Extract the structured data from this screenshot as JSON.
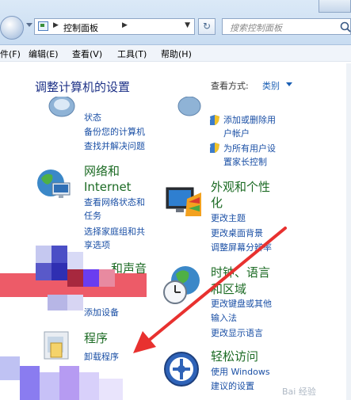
{
  "toolbar": {
    "address_text": "控制面板",
    "search_placeholder": "搜索控制面板"
  },
  "menu": [
    "件(F)",
    "编辑(E)",
    "查看(V)",
    "工具(T)",
    "帮助(H)"
  ],
  "header": {
    "title": "调整计算机的设置",
    "view_by_label": "查看方式:",
    "view_by_value": "类别"
  },
  "left_categories": [
    {
      "title": "",
      "links": [
        "状态",
        "备份您的计算机",
        "查找并解决问题"
      ]
    },
    {
      "title_line1": "网络和",
      "title_line2": "Internet",
      "links": [
        "查看网络状态和",
        "任务",
        "选择家庭组和共",
        "享选项"
      ]
    },
    {
      "title": "和声音",
      "links": [
        "添加设备"
      ]
    },
    {
      "title": "程序",
      "links": [
        "卸载程序"
      ]
    }
  ],
  "right_categories": [
    {
      "links": [
        "添加或删除用",
        "户帐户",
        "为所有用户设",
        "置家长控制"
      ]
    },
    {
      "title_line1": "外观和个性",
      "title_line2": "化",
      "links": [
        "更改主题",
        "更改桌面背景",
        "调整屏幕分辨率"
      ]
    },
    {
      "title_line1": "时钟、语言",
      "title_line2": "和区域",
      "links": [
        "更改键盘或其他",
        "输入法",
        "更改显示语言"
      ]
    },
    {
      "title": "轻松访问",
      "links": [
        "使用 Windows",
        "建议的设置"
      ]
    }
  ],
  "watermark": "Bai 经验",
  "colors": {
    "category_title": "#1c6b24",
    "link": "#1a4fa5",
    "accent_arrow": "#e8312f"
  }
}
